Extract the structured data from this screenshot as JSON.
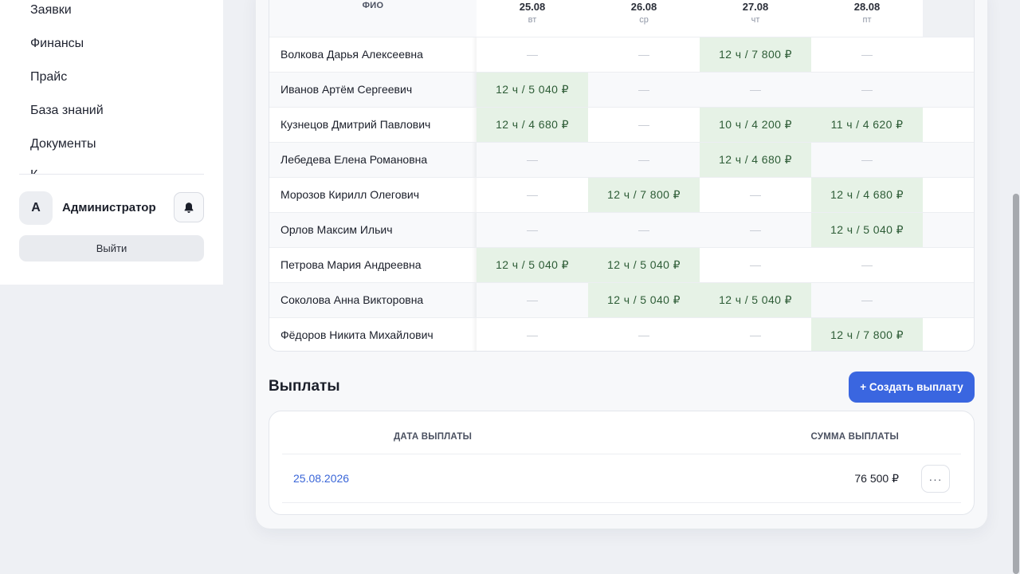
{
  "sidebar": {
    "items": [
      {
        "label": "Заявки"
      },
      {
        "label": "Финансы"
      },
      {
        "label": "Прайс"
      },
      {
        "label": "База знаний"
      },
      {
        "label": "Документы"
      },
      {
        "label": "К"
      }
    ],
    "user": {
      "avatar_letter": "А",
      "name": "Администратор"
    },
    "bell_icon": "bell-icon",
    "logout_label": "Выйти"
  },
  "schedule": {
    "name_header": "ФИО",
    "days": [
      {
        "date": "25.08",
        "weekday": "вт"
      },
      {
        "date": "26.08",
        "weekday": "ср"
      },
      {
        "date": "27.08",
        "weekday": "чт"
      },
      {
        "date": "28.08",
        "weekday": "пт"
      }
    ],
    "empty_mark": "—",
    "filled_color": "#e6f2e6",
    "rows": [
      {
        "name": "Волкова Дарья Алексеевна",
        "cells": [
          "—",
          "—",
          "12 ч / 7 800 ₽",
          "—"
        ]
      },
      {
        "name": "Иванов Артём Сергеевич",
        "cells": [
          "12 ч / 5 040 ₽",
          "—",
          "—",
          "—"
        ]
      },
      {
        "name": "Кузнецов Дмитрий Павлович",
        "cells": [
          "12 ч / 4 680 ₽",
          "—",
          "10 ч / 4 200 ₽",
          "11 ч / 4 620 ₽"
        ]
      },
      {
        "name": "Лебедева Елена Романовна",
        "cells": [
          "—",
          "—",
          "12 ч / 4 680 ₽",
          "—"
        ]
      },
      {
        "name": "Морозов Кирилл Олегович",
        "cells": [
          "—",
          "12 ч / 7 800 ₽",
          "—",
          "12 ч / 4 680 ₽"
        ]
      },
      {
        "name": "Орлов Максим Ильич",
        "cells": [
          "—",
          "—",
          "—",
          "12 ч / 5 040 ₽"
        ]
      },
      {
        "name": "Петрова Мария Андреевна",
        "cells": [
          "12 ч / 5 040 ₽",
          "12 ч / 5 040 ₽",
          "—",
          "—"
        ]
      },
      {
        "name": "Соколова Анна Викторовна",
        "cells": [
          "—",
          "12 ч / 5 040 ₽",
          "12 ч / 5 040 ₽",
          "—"
        ]
      },
      {
        "name": "Фёдоров Никита Михайлович",
        "cells": [
          "—",
          "—",
          "—",
          "12 ч / 7 800 ₽"
        ]
      }
    ]
  },
  "payments": {
    "title": "Выплаты",
    "create_label": "+ Создать выплату",
    "accent_color": "#3a66e0",
    "columns": {
      "date": "ДАТА ВЫПЛАТЫ",
      "sum": "СУММА ВЫПЛАТЫ"
    },
    "rows": [
      {
        "date": "25.08.2026",
        "sum": "76 500 ₽",
        "more_icon": "more-horizontal-icon"
      }
    ],
    "more_glyph": "···"
  }
}
